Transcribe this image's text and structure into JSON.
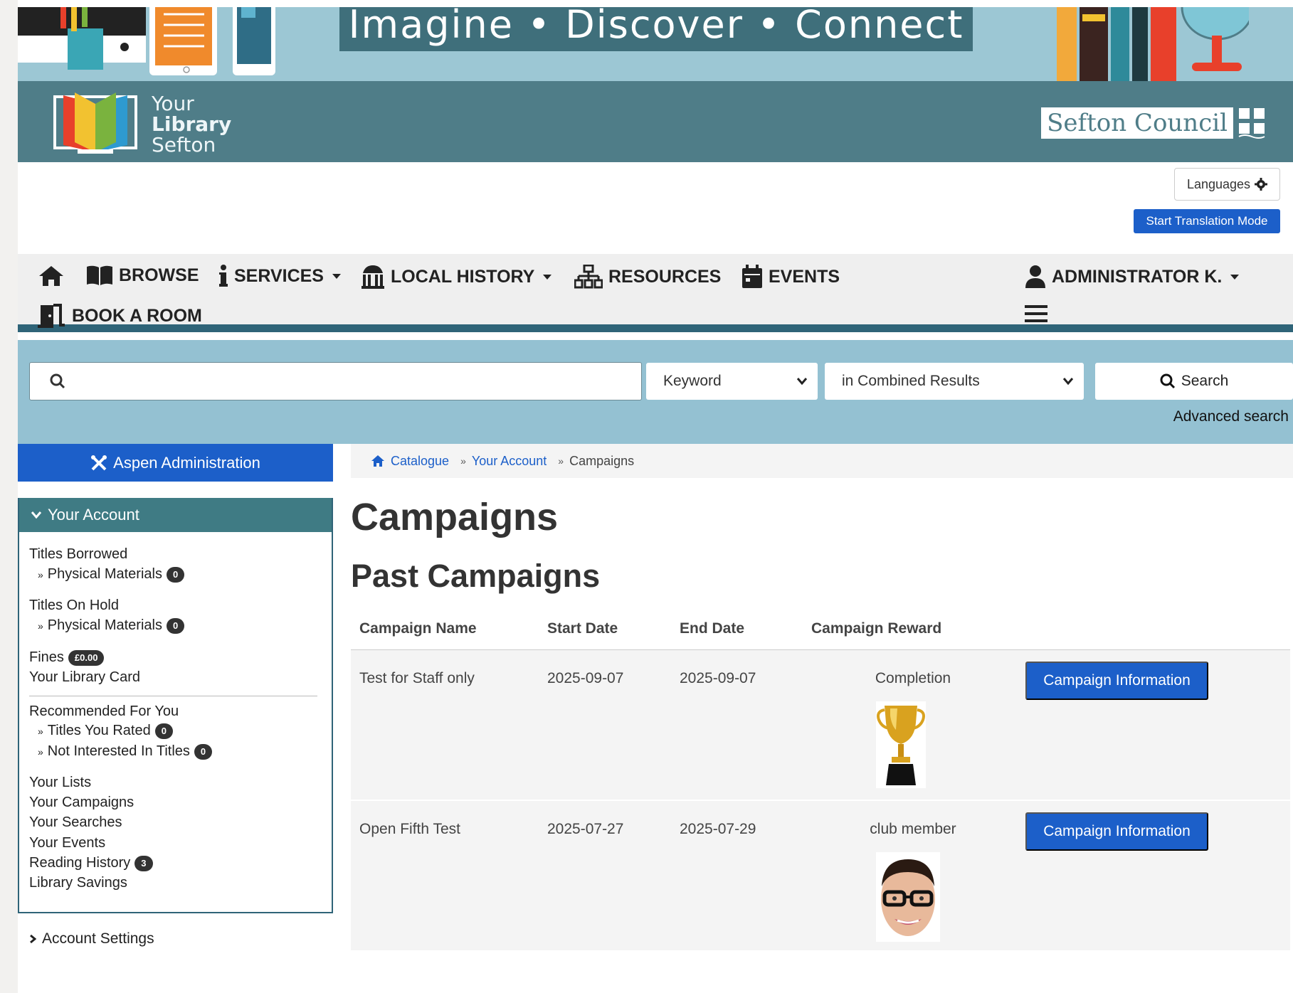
{
  "header": {
    "tagline": "Imagine • Discover • Connect",
    "logo": {
      "line1": "Your",
      "line2": "Library",
      "line3": "Sefton"
    },
    "council": "Sefton Council"
  },
  "language": {
    "languages_label": "Languages",
    "translation_label": "Start Translation Mode"
  },
  "nav": {
    "browse": "BROWSE",
    "services": "SERVICES",
    "local_history": "LOCAL HISTORY",
    "resources": "RESOURCES",
    "events": "EVENTS",
    "book_room": "BOOK A ROOM",
    "user": "ADMINISTRATOR K."
  },
  "search": {
    "placeholder": "",
    "type_selected": "Keyword",
    "scope_selected": "in Combined Results",
    "button_label": "Search",
    "advanced_label": "Advanced search"
  },
  "sidebar": {
    "admin_label": "Aspen Administration",
    "account_header": "Your Account",
    "titles_borrowed": "Titles Borrowed",
    "borrowed_physical": "Physical Materials",
    "borrowed_count": "0",
    "titles_on_hold": "Titles On Hold",
    "hold_physical": "Physical Materials",
    "hold_count": "0",
    "fines": "Fines",
    "fines_amount": "£0.00",
    "library_card": "Your Library Card",
    "recommended": "Recommended For You",
    "titles_rated": "Titles You Rated",
    "titles_rated_count": "0",
    "not_interested": "Not Interested In Titles",
    "not_interested_count": "0",
    "your_lists": "Your Lists",
    "your_campaigns": "Your Campaigns",
    "your_searches": "Your Searches",
    "your_events": "Your Events",
    "reading_history": "Reading History",
    "reading_history_count": "3",
    "library_savings": "Library Savings",
    "account_settings": "Account Settings"
  },
  "breadcrumb": {
    "catalogue": "Catalogue",
    "account": "Your Account",
    "current": "Campaigns",
    "separator": "»"
  },
  "main": {
    "title": "Campaigns",
    "section": "Past Campaigns",
    "columns": [
      "Campaign Name",
      "Start Date",
      "End Date",
      "Campaign Reward"
    ],
    "rows": [
      {
        "name": "Test for Staff only",
        "start": "2025-09-07",
        "end": "2025-09-07",
        "reward": "Completion",
        "button": "Campaign Information"
      },
      {
        "name": "Open Fifth Test",
        "start": "2025-07-27",
        "end": "2025-07-29",
        "reward": "club member",
        "button": "Campaign Information"
      }
    ]
  },
  "colors": {
    "brand_teal": "#4f7d88",
    "nav_border": "#2f6478",
    "search_band": "#94c1d2",
    "primary_button": "#1c5fc9"
  }
}
